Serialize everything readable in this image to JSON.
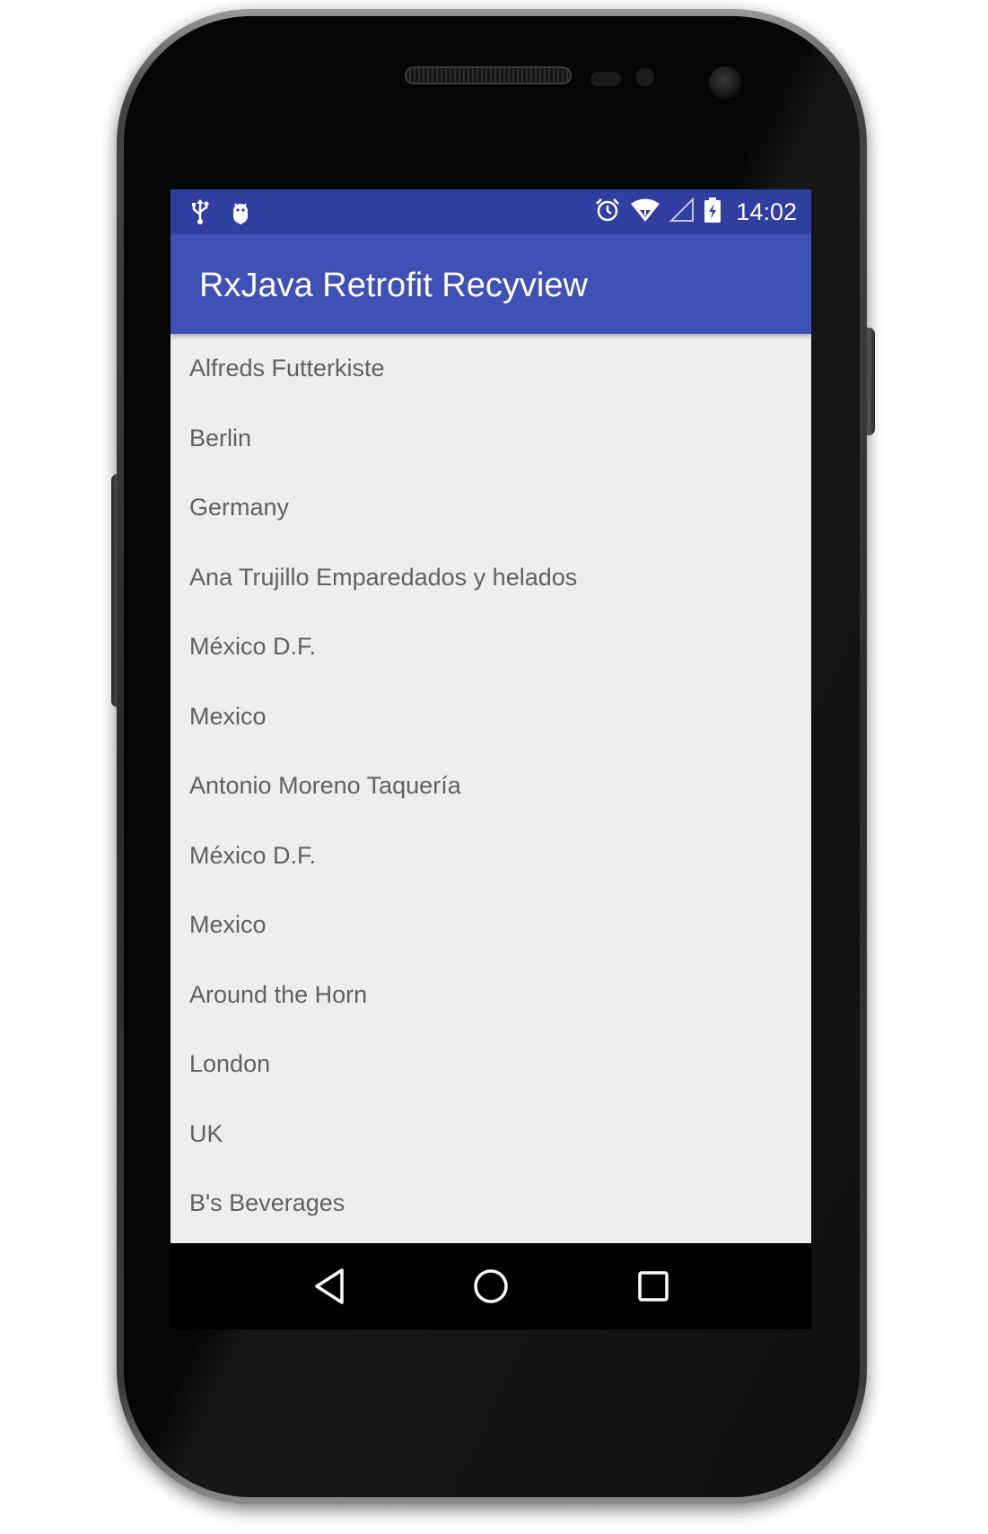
{
  "status_bar": {
    "time": "14:02",
    "left_icons": [
      "usb-icon",
      "android-debug-icon"
    ],
    "right_icons": [
      "alarm-icon",
      "wifi-icon",
      "cell-signal-icon",
      "battery-charging-icon"
    ]
  },
  "toolbar": {
    "title": "RxJava Retrofit Recyview"
  },
  "list": {
    "items": [
      "Alfreds Futterkiste",
      "Berlin",
      "Germany",
      "Ana Trujillo Emparedados y helados",
      "México D.F.",
      "Mexico",
      "Antonio Moreno Taquería",
      "México D.F.",
      "Mexico",
      "Around the Horn",
      "London",
      "UK",
      "B's Beverages"
    ]
  },
  "nav_bar": {
    "buttons": [
      "back-icon",
      "home-icon",
      "recents-icon"
    ]
  },
  "colors": {
    "status_bar": "#303f9f",
    "toolbar": "#3f51b5",
    "background": "#eeeeee",
    "text": "#616161"
  }
}
